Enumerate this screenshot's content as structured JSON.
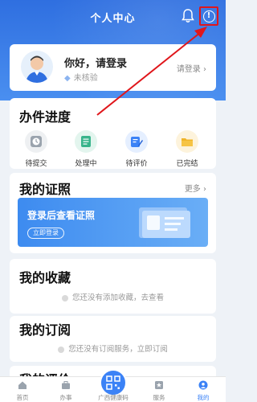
{
  "header": {
    "title": "个人中心"
  },
  "user": {
    "greeting": "你好，请登录",
    "status": "未核验",
    "login_link": "请登录 ›"
  },
  "progress": {
    "title": "办件进度",
    "items": [
      {
        "label": "待提交",
        "icon": "clock-icon",
        "color": "#9aa3ad"
      },
      {
        "label": "处理中",
        "icon": "document-icon",
        "color": "#38b48b"
      },
      {
        "label": "待评价",
        "icon": "edit-icon",
        "color": "#3b82f6"
      },
      {
        "label": "已完结",
        "icon": "folder-icon",
        "color": "#f0b429"
      }
    ]
  },
  "certificates": {
    "title": "我的证照",
    "more": "更多 ›",
    "banner_text": "登录后查看证照",
    "banner_button": "立即登录"
  },
  "favorites": {
    "title": "我的收藏",
    "empty_text": "您还没有添加收藏，去查看"
  },
  "subscriptions": {
    "title": "我的订阅",
    "empty_text": "您还没有订阅服务，立即订阅"
  },
  "evaluations": {
    "title": "我的评价"
  },
  "tabbar": {
    "items": [
      {
        "label": "首页",
        "icon": "home-icon"
      },
      {
        "label": "办事",
        "icon": "briefcase-icon"
      },
      {
        "label": "广西健康码",
        "icon": "qr-code-icon"
      },
      {
        "label": "服务",
        "icon": "star-icon"
      },
      {
        "label": "我的",
        "icon": "user-icon"
      }
    ],
    "active": "我的"
  },
  "colors": {
    "primary": "#3b82f6",
    "header": "#2f6fe0",
    "annotation": "#e0161b"
  }
}
